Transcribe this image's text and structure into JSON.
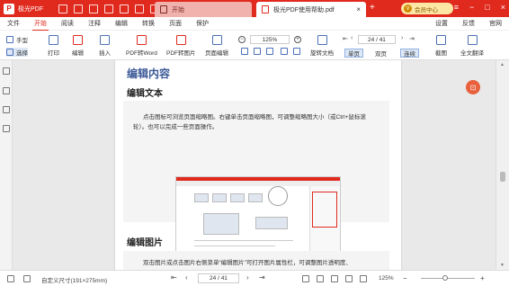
{
  "titlebar": {
    "app_name": "极光PDF",
    "home_tab": "开始",
    "active_tab": "极光PDF使用帮助.pdf",
    "close": "×",
    "add_tab": "+",
    "vip_label": "会员中心",
    "vip_badge": "V",
    "accent": "#e02a1e"
  },
  "menu": {
    "items": [
      "文件",
      "开始",
      "阅读",
      "注释",
      "编辑",
      "转换",
      "页面",
      "保护"
    ],
    "active": "开始",
    "right_items": [
      "设置",
      "反馈",
      "官网"
    ]
  },
  "toolbar": {
    "hand": "手型",
    "select": "选择",
    "print": "打印",
    "edit": "编辑",
    "insert": "插入",
    "pdf_to_word": "PDF转Word",
    "pdf_to_image": "PDF转图片",
    "page_edit": "页面编辑",
    "zoom": "125%",
    "rotate": "旋转文档",
    "page_indicator": "24 / 41",
    "single": "单页",
    "double": "双页",
    "continuous": "连续",
    "screenshot": "截图",
    "translate": "全文翻译"
  },
  "document": {
    "heading": "编辑内容",
    "section1_title": "编辑文本",
    "section1_text": "点击图标可浏览页面缩略图。右键单击页面缩略图，可调整缩略图大小（或Ctrl+鼠标滚轮）。也可以完成一些页面操作。",
    "section2_title": "编辑图片",
    "section2_text": "双击图片或点击图片右侧菜单“编辑图片”可打开图片属性栏，可调整图片透明度、"
  },
  "statusbar": {
    "page_size": "自定义尺寸(191×275mm)",
    "page_indicator": "24 / 41",
    "zoom": "125%"
  }
}
